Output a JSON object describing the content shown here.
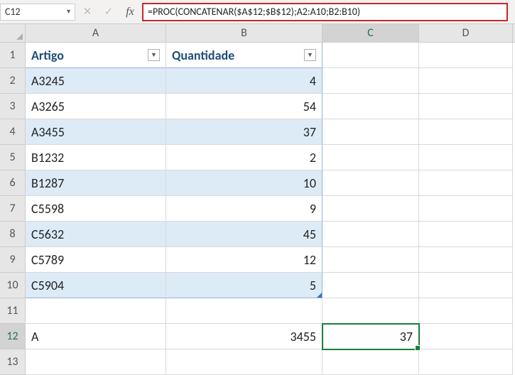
{
  "formulaBar": {
    "nameBox": "C12",
    "formula": "=PROC(CONCATENAR($A$12;$B$12);A2:A10;B2:B10)"
  },
  "columns": {
    "A": "A",
    "B": "B",
    "C": "C",
    "D": "D"
  },
  "header": {
    "artigo": "Artigo",
    "quantidade": "Quantidade"
  },
  "rows": [
    {
      "n": "1"
    },
    {
      "n": "2",
      "a": "A3245",
      "b": "4"
    },
    {
      "n": "3",
      "a": "A3265",
      "b": "54"
    },
    {
      "n": "4",
      "a": "A3455",
      "b": "37"
    },
    {
      "n": "5",
      "a": "B1232",
      "b": "2"
    },
    {
      "n": "6",
      "a": "B1287",
      "b": "10"
    },
    {
      "n": "7",
      "a": "C5598",
      "b": "9"
    },
    {
      "n": "8",
      "a": "C5632",
      "b": "45"
    },
    {
      "n": "9",
      "a": "C5789",
      "b": "12"
    },
    {
      "n": "10",
      "a": "C5904",
      "b": "5"
    },
    {
      "n": "11"
    },
    {
      "n": "12",
      "a": "A",
      "b": "3455",
      "c": "37"
    },
    {
      "n": "13"
    }
  ]
}
